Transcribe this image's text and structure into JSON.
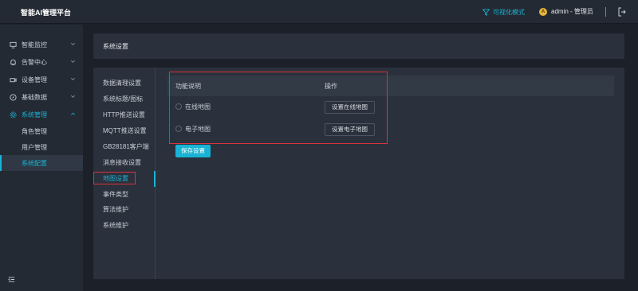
{
  "app": {
    "title": "智能AI管理平台"
  },
  "header": {
    "visual_mode_label": "可视化模式",
    "user_initial": "A",
    "user_label": "admin - 管理员"
  },
  "sidebar": {
    "menus": [
      {
        "label": "智能监控",
        "icon": "monitor-icon"
      },
      {
        "label": "告警中心",
        "icon": "bell-icon"
      },
      {
        "label": "设备管理",
        "icon": "camera-icon"
      },
      {
        "label": "基础数据",
        "icon": "compass-icon"
      },
      {
        "label": "系统管理",
        "icon": "gear-icon"
      }
    ],
    "sub_items": [
      {
        "label": "角色管理"
      },
      {
        "label": "用户管理"
      },
      {
        "label": "系统配置"
      }
    ],
    "active_sub": "系统配置"
  },
  "page": {
    "title": "系统设置"
  },
  "settings_nav": [
    "数据清理设置",
    "系统标题/图标",
    "HTTP推送设置",
    "MQTT推送设置",
    "GB28181客户端",
    "消息接收设置",
    "地图设置",
    "事件类型",
    "算法维护",
    "系统维护"
  ],
  "settings_nav_active": "地图设置",
  "map_table": {
    "columns": [
      "功能说明",
      "操作"
    ],
    "rows": [
      {
        "label": "在线地图",
        "button": "设置在线地图"
      },
      {
        "label": "电子地图",
        "button": "设置电子地图"
      }
    ],
    "save_label": "保存设置"
  },
  "colors": {
    "accent": "#19b3d4",
    "highlight_box": "#d9323c",
    "background": "#1b2029",
    "panel": "#2a313c"
  }
}
